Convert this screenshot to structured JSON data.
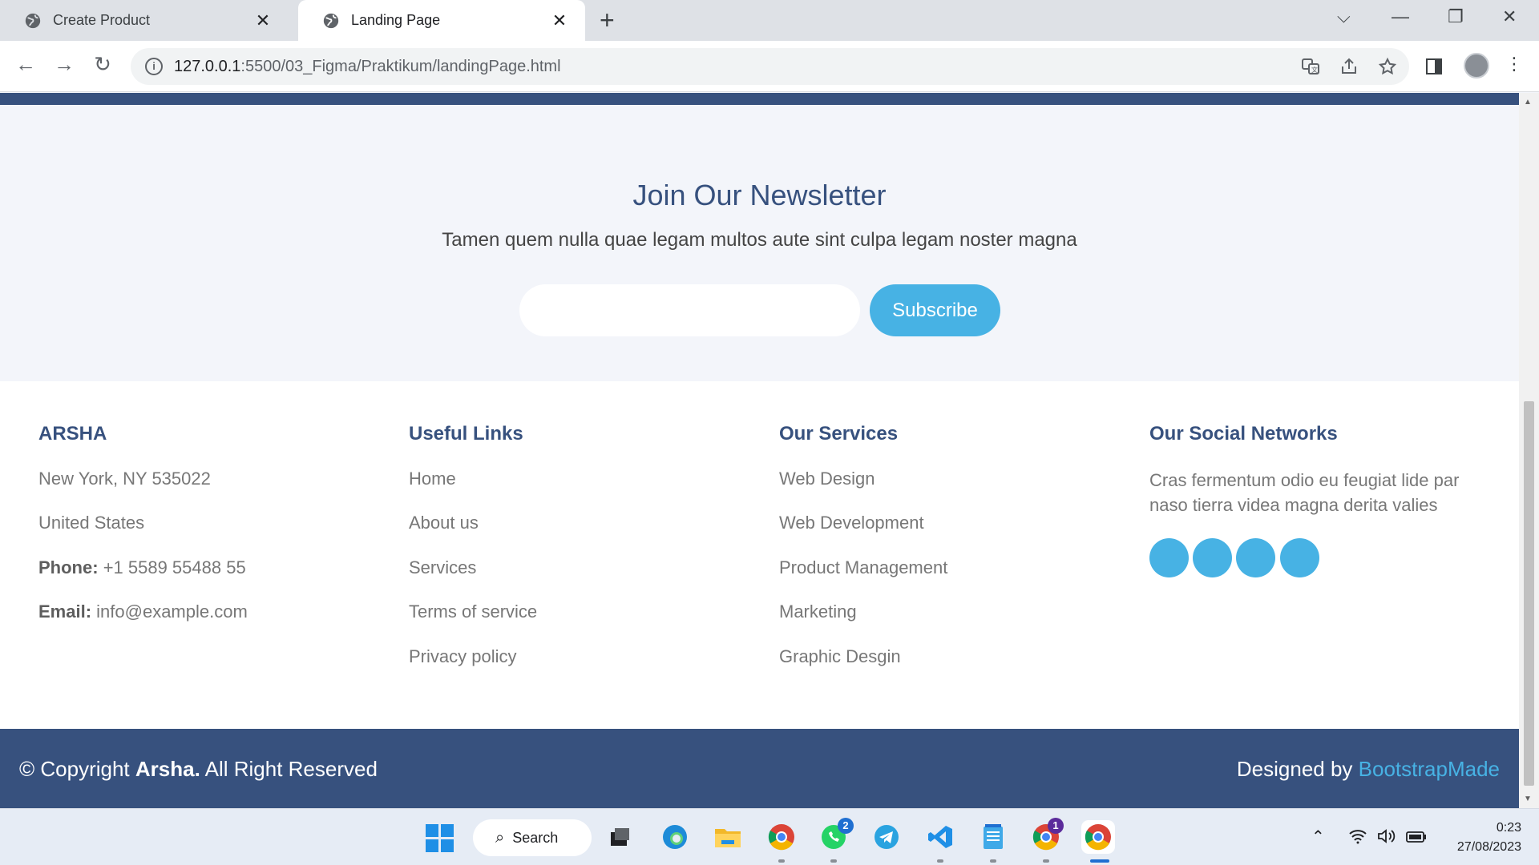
{
  "browser": {
    "tabs": [
      {
        "title": "Create Product",
        "close": "✕"
      },
      {
        "title": "Landing Page",
        "close": "✕"
      }
    ],
    "new_tab": "+",
    "url_host": "127.0.0.1",
    "url_path": ":5500/03_Figma/Praktikum/landingPage.html",
    "nav": {
      "back": "←",
      "forward": "→",
      "reload": "↻"
    },
    "window_controls": {
      "tabs_menu": "⌵",
      "minimize": "—",
      "restore": "❐",
      "close": "✕"
    }
  },
  "newsletter": {
    "title": "Join Our Newsletter",
    "subtitle": "Tamen quem nulla quae legam multos aute sint culpa legam noster magna",
    "email_value": "",
    "button_label": "Subscribe"
  },
  "footer": {
    "contact": {
      "title": "ARSHA",
      "address1": "New York, NY 535022",
      "address2": "United States",
      "phone_label": "Phone:",
      "phone": "+1 5589 55488 55",
      "email_label": "Email:",
      "email": "info@example.com"
    },
    "links": {
      "title": "Useful Links",
      "items": [
        "Home",
        "About us",
        "Services",
        "Terms of service",
        "Privacy policy"
      ]
    },
    "services": {
      "title": "Our Services",
      "items": [
        "Web Design",
        "Web Development",
        "Product Management",
        "Marketing",
        "Graphic Desgin"
      ]
    },
    "social": {
      "title": "Our Social Networks",
      "text": "Cras fermentum odio eu feugiat lide par naso tierra videa magna derita valies"
    },
    "bottom": {
      "copyright_prefix": "© Copyright",
      "copyright_brand": "Arsha.",
      "copyright_suffix": "All Right Reserved",
      "credits_prefix": "Designed by",
      "credits_brand": "BootstrapMade"
    }
  },
  "taskbar": {
    "search_label": "Search",
    "whatsapp_badge": "2",
    "chrome_badge": "1",
    "time": "0:23",
    "date": "27/08/2023"
  },
  "colors": {
    "primary": "#37517e",
    "accent": "#47b2e4",
    "page_bg": "#f3f5fa"
  }
}
